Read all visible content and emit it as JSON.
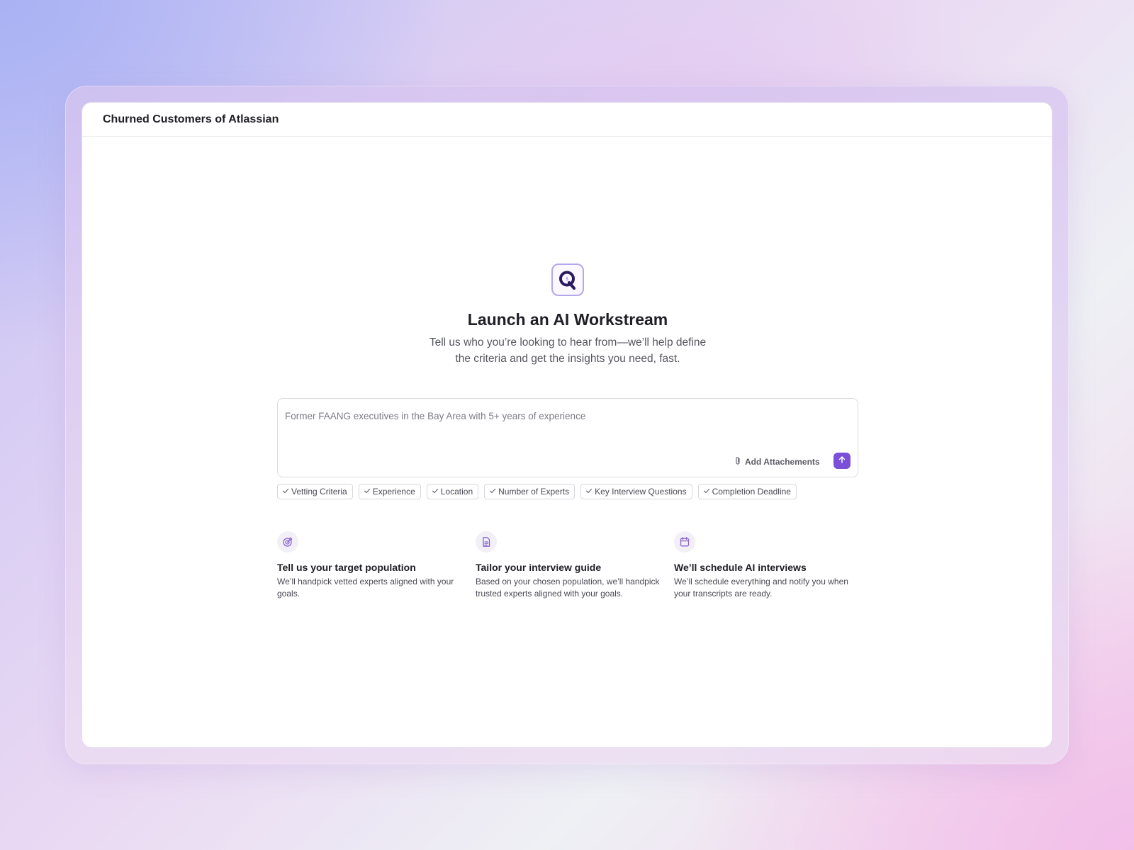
{
  "window": {
    "title": "Churned Customers of Atlassian"
  },
  "hero": {
    "logo": "q-logo-icon",
    "title": "Launch an AI Workstream",
    "subtitle": "Tell us who you’re looking to hear from—we’ll help define the criteria and get the insights you need, fast."
  },
  "prompt": {
    "value": "",
    "placeholder": "Former FAANG executives in the Bay Area with 5+ years of experience",
    "attach_label": "Add Attachements",
    "attach_icon": "paperclip-icon",
    "send_icon": "arrow-up-icon"
  },
  "chips": [
    {
      "label": "Vetting Criteria",
      "icon": "check-icon"
    },
    {
      "label": "Experience",
      "icon": "check-icon"
    },
    {
      "label": "Location",
      "icon": "check-icon"
    },
    {
      "label": "Number of Experts",
      "icon": "check-icon"
    },
    {
      "label": "Key Interview Questions",
      "icon": "check-icon"
    },
    {
      "label": "Completion Deadline",
      "icon": "check-icon"
    }
  ],
  "features": [
    {
      "icon": "target-icon",
      "title": "Tell us your target population",
      "description": "We’ll handpick vetted experts aligned with your goals."
    },
    {
      "icon": "document-icon",
      "title": "Tailor your interview guide",
      "description": "Based on your chosen population, we’ll handpick trusted experts aligned with your goals."
    },
    {
      "icon": "calendar-icon",
      "title": "We’ll schedule AI interviews",
      "description": "We’ll schedule everything and notify you when your transcripts are ready."
    }
  ],
  "colors": {
    "accent": "#7b4fd8",
    "logo_dark": "#2b1a5e",
    "icon_purple": "#8a63d2"
  }
}
